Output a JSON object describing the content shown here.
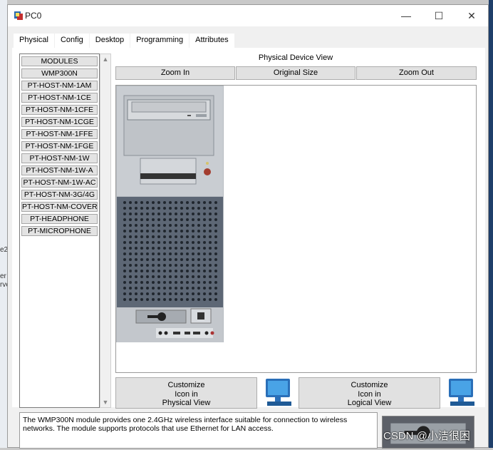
{
  "background": {
    "fragments": [
      "e2",
      "er",
      "rve"
    ]
  },
  "window": {
    "title": "PC0",
    "controls": {
      "minimize": "—",
      "maximize": "☐",
      "close": "✕"
    }
  },
  "tabs": [
    {
      "label": "Physical",
      "active": true
    },
    {
      "label": "Config"
    },
    {
      "label": "Desktop"
    },
    {
      "label": "Programming"
    },
    {
      "label": "Attributes"
    }
  ],
  "modules": {
    "items": [
      "MODULES",
      "WMP300N",
      "PT-HOST-NM-1AM",
      "PT-HOST-NM-1CE",
      "PT-HOST-NM-1CFE",
      "PT-HOST-NM-1CGE",
      "PT-HOST-NM-1FFE",
      "PT-HOST-NM-1FGE",
      "PT-HOST-NM-1W",
      "PT-HOST-NM-1W-A",
      "PT-HOST-NM-1W-AC",
      "PT-HOST-NM-3G/4G",
      "PT-HOST-NM-COVER",
      "PT-HEADPHONE",
      "PT-MICROPHONE"
    ]
  },
  "physical_view": {
    "label": "Physical Device View",
    "zoom_in": "Zoom In",
    "original_size": "Original Size",
    "zoom_out": "Zoom Out"
  },
  "customize_physical": {
    "line1": "Customize",
    "line2": "Icon in",
    "line3": "Physical View"
  },
  "customize_logical": {
    "line1": "Customize",
    "line2": "Icon in",
    "line3": "Logical View"
  },
  "description": "The WMP300N module provides one 2.4GHz wireless interface suitable for connection to wireless networks. The module supports protocols that use Ethernet for LAN access.",
  "watermark": "CSDN @小洁很困",
  "colors": {
    "tab_underline": "#1f4e79",
    "pc_body": "#c3c7cc",
    "grille": "#5a6573",
    "window_bg": "#f0f0f0"
  }
}
